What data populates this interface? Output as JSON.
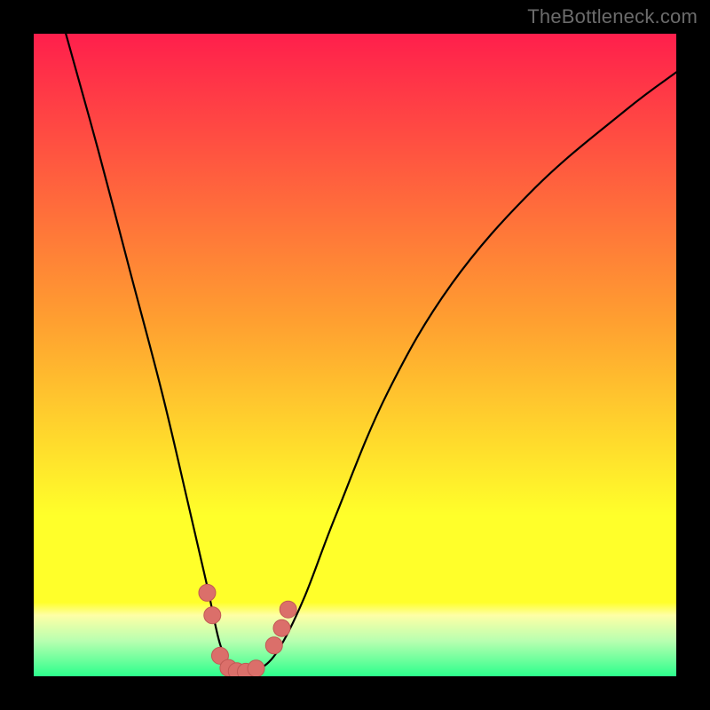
{
  "attribution": "TheBottleneck.com",
  "colors": {
    "top_red": "#ff1f4c",
    "mid_orange": "#ffa030",
    "yellow": "#ffff2a",
    "pale_yellow": "#feffa6",
    "pale_green": "#b8ffb0",
    "green": "#2cff8c",
    "curve": "#000000",
    "marker_fill": "#db6f6a",
    "marker_stroke": "#c15955"
  },
  "chart_data": {
    "type": "line",
    "title": "",
    "xlabel": "",
    "ylabel": "",
    "xlim": [
      0,
      100
    ],
    "ylim": [
      0,
      100
    ],
    "legend": false,
    "grid": false,
    "series": [
      {
        "name": "bottleneck-curve",
        "x": [
          5,
          10,
          15,
          20,
          24,
          27,
          29,
          31,
          33,
          35,
          38,
          42,
          47,
          55,
          65,
          78,
          92,
          100
        ],
        "y": [
          100,
          82,
          63,
          44,
          27,
          14,
          5,
          1,
          0.4,
          1,
          4,
          12,
          25,
          44,
          61,
          76,
          88,
          94
        ]
      }
    ],
    "markers": [
      {
        "x": 27.0,
        "y": 13
      },
      {
        "x": 27.8,
        "y": 9.5
      },
      {
        "x": 29.0,
        "y": 3.2
      },
      {
        "x": 30.3,
        "y": 1.3
      },
      {
        "x": 31.6,
        "y": 0.8
      },
      {
        "x": 33.0,
        "y": 0.7
      },
      {
        "x": 34.6,
        "y": 1.2
      },
      {
        "x": 37.4,
        "y": 4.8
      },
      {
        "x": 38.6,
        "y": 7.5
      },
      {
        "x": 39.6,
        "y": 10.4
      }
    ],
    "gradient_stops": [
      {
        "offset": 0.0,
        "name": "top_red"
      },
      {
        "offset": 0.45,
        "name": "mid_orange"
      },
      {
        "offset": 0.75,
        "name": "yellow"
      },
      {
        "offset": 0.885,
        "name": "yellow"
      },
      {
        "offset": 0.905,
        "name": "pale_yellow"
      },
      {
        "offset": 0.945,
        "name": "pale_green"
      },
      {
        "offset": 1.0,
        "name": "green"
      }
    ]
  }
}
